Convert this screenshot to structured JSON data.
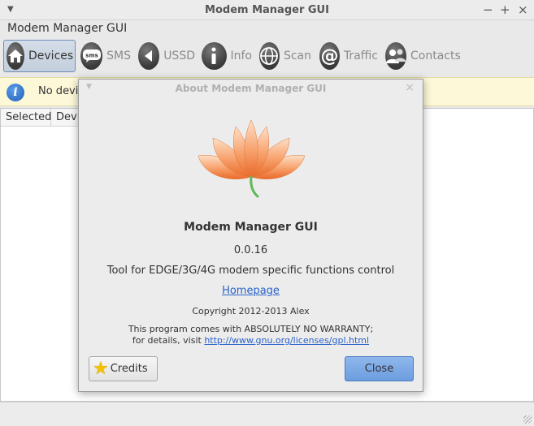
{
  "window": {
    "title": "Modem Manager GUI",
    "app_name": "Modem Manager GUI",
    "controls": {
      "minimize": "−",
      "maximize": "+",
      "close": "×"
    }
  },
  "toolbar": {
    "items": [
      {
        "label": "Devices",
        "icon": "home-icon",
        "active": true
      },
      {
        "label": "SMS",
        "icon": "sms-icon",
        "active": false
      },
      {
        "label": "USSD",
        "icon": "ussd-icon",
        "active": false
      },
      {
        "label": "Info",
        "icon": "info-icon",
        "active": false
      },
      {
        "label": "Scan",
        "icon": "scan-icon",
        "active": false
      },
      {
        "label": "Traffic",
        "icon": "traffic-icon",
        "active": false
      },
      {
        "label": "Contacts",
        "icon": "contacts-icon",
        "active": false
      }
    ]
  },
  "infobar": {
    "text": "No devic"
  },
  "table": {
    "columns": [
      "Selected",
      "Devic"
    ]
  },
  "about_dialog": {
    "title": "About Modem Manager GUI",
    "program_name": "Modem Manager GUI",
    "version": "0.0.16",
    "comments": "Tool for EDGE/3G/4G modem specific functions control",
    "homepage_label": "Homepage",
    "copyright": "Copyright 2012-2013 Alex",
    "license_line1": "This program comes with ABSOLUTELY NO WARRANTY;",
    "license_line2_prefix": "for details, visit ",
    "license_url": "http://www.gnu.org/licenses/gpl.html",
    "credits_label": "Credits",
    "close_label": "Close"
  },
  "colors": {
    "accent": "#6c9ddf",
    "infobar_bg": "#fcf8d8",
    "lotus": "#f08a4b"
  }
}
